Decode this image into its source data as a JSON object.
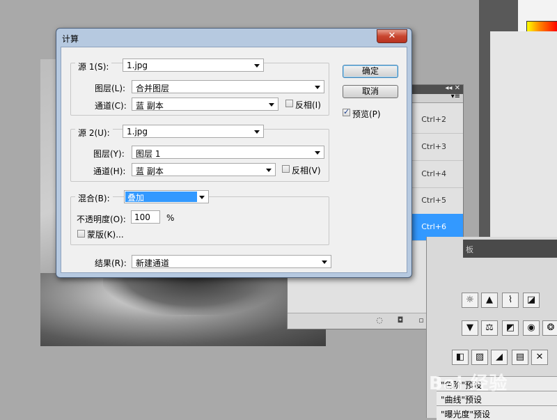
{
  "dialog": {
    "title": "计算",
    "close_glyph": "✕",
    "source1": {
      "label": "源 1(S):",
      "file": "1.jpg",
      "layer_label": "图层(L):",
      "layer": "合并图层",
      "channel_label": "通道(C):",
      "channel": "蓝 副本",
      "invert_label": "反相(I)",
      "invert_checked": false
    },
    "source2": {
      "label": "源 2(U):",
      "file": "1.jpg",
      "layer_label": "图层(Y):",
      "layer": "图层 1",
      "channel_label": "通道(H):",
      "channel": "蓝 副本",
      "invert_label": "反相(V)",
      "invert_checked": false
    },
    "blending": {
      "label": "混合(B):",
      "mode": "叠加",
      "opacity_label": "不透明度(O):",
      "opacity": "100",
      "opacity_unit": "%",
      "mask_label": "蒙版(K)..."
    },
    "result": {
      "label": "结果(R):",
      "value": "新建通道"
    },
    "buttons": {
      "ok": "确定",
      "cancel": "取消",
      "preview_label": "预览(P)",
      "preview_checked": true
    }
  },
  "channels_panel": {
    "header_glyph": "◂◂ ✕",
    "menu_glyph": "▾≡",
    "rows": [
      {
        "shortcut": "Ctrl+2",
        "selected": false
      },
      {
        "shortcut": "Ctrl+3",
        "selected": false
      },
      {
        "shortcut": "Ctrl+4",
        "selected": false
      },
      {
        "shortcut": "Ctrl+5",
        "selected": false
      },
      {
        "shortcut": "Ctrl+6",
        "selected": true
      }
    ],
    "footer_icons": [
      "dotted-circle-icon",
      "mask-icon",
      "new-channel-icon",
      "trash-icon"
    ]
  },
  "adjustments_panel": {
    "header_text": "板",
    "icons": [
      "brightness-icon",
      "levels-icon",
      "curves-icon",
      "exposure-icon",
      "vibrance-icon",
      "hue-icon",
      "balance-icon",
      "bw-icon",
      "photo-filter-icon",
      "mixer-icon",
      "invert-icon",
      "posterize-icon",
      "threshold-icon",
      "gradient-map-icon",
      "selective-color-icon"
    ],
    "presets": [
      "\"色阶\"预设",
      "\"曲线\"预设",
      "\"曝光度\"预设"
    ],
    "preset_arrow": "▶"
  },
  "watermark": "Bai 经验"
}
